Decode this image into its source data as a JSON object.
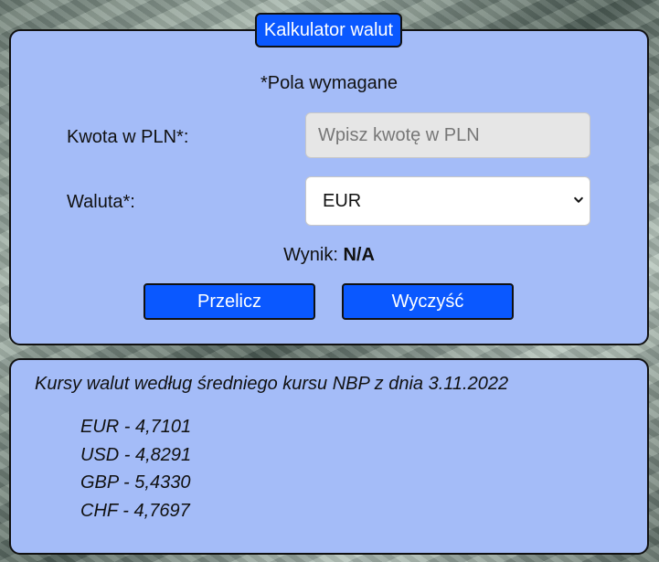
{
  "calculator": {
    "title": "Kalkulator walut",
    "required_note": "*Pola wymagane",
    "amount_label": "Kwota w PLN*:",
    "amount_value": "",
    "amount_placeholder": "Wpisz kwotę w PLN",
    "currency_label": "Waluta*:",
    "currency_selected": "EUR",
    "result_label": "Wynik:",
    "result_value": "N/A",
    "convert_label": "Przelicz",
    "clear_label": "Wyczyść"
  },
  "rates": {
    "heading": "Kursy walut według średniego kursu NBP z dnia 3.11.2022",
    "items": [
      {
        "text": "EUR - 4,7101"
      },
      {
        "text": "USD - 4,8291"
      },
      {
        "text": "GBP - 5,4330"
      },
      {
        "text": "CHF - 4,7697"
      }
    ]
  },
  "icons": {
    "select_arrow": "chevron-down-icon"
  },
  "colors": {
    "panel_background": "#a4bcf8",
    "accent_blue": "#0a58ff",
    "input_disabled_background": "#e6e6e6",
    "text_dark": "#111111"
  }
}
